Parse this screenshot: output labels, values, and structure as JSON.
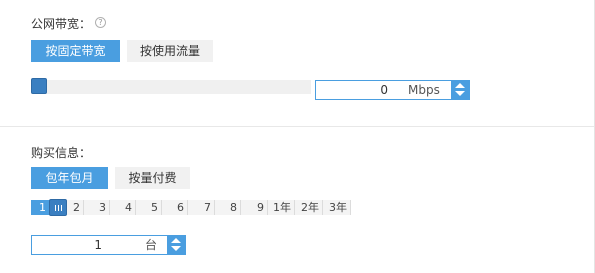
{
  "bandwidth": {
    "label": "公网带宽：",
    "help_glyph": "?",
    "tabs": [
      {
        "label": "按固定带宽",
        "active": true
      },
      {
        "label": "按使用流量",
        "active": false
      }
    ],
    "slider_value": 0,
    "input_value": "0",
    "unit": "Mbps"
  },
  "purchase": {
    "label": "购买信息：",
    "tabs": [
      {
        "label": "包年包月",
        "active": true
      },
      {
        "label": "按量付费",
        "active": false
      }
    ],
    "duration_ticks": [
      "1",
      "2",
      "3",
      "4",
      "5",
      "6",
      "7",
      "8",
      "9",
      "1年",
      "2年",
      "3年"
    ],
    "selected_duration": "1",
    "quantity_value": "1",
    "quantity_unit": "台"
  },
  "colors": {
    "accent": "#4a9ee0",
    "handle": "#3a7fc1",
    "inactive_tab": "#f1f1f1"
  }
}
